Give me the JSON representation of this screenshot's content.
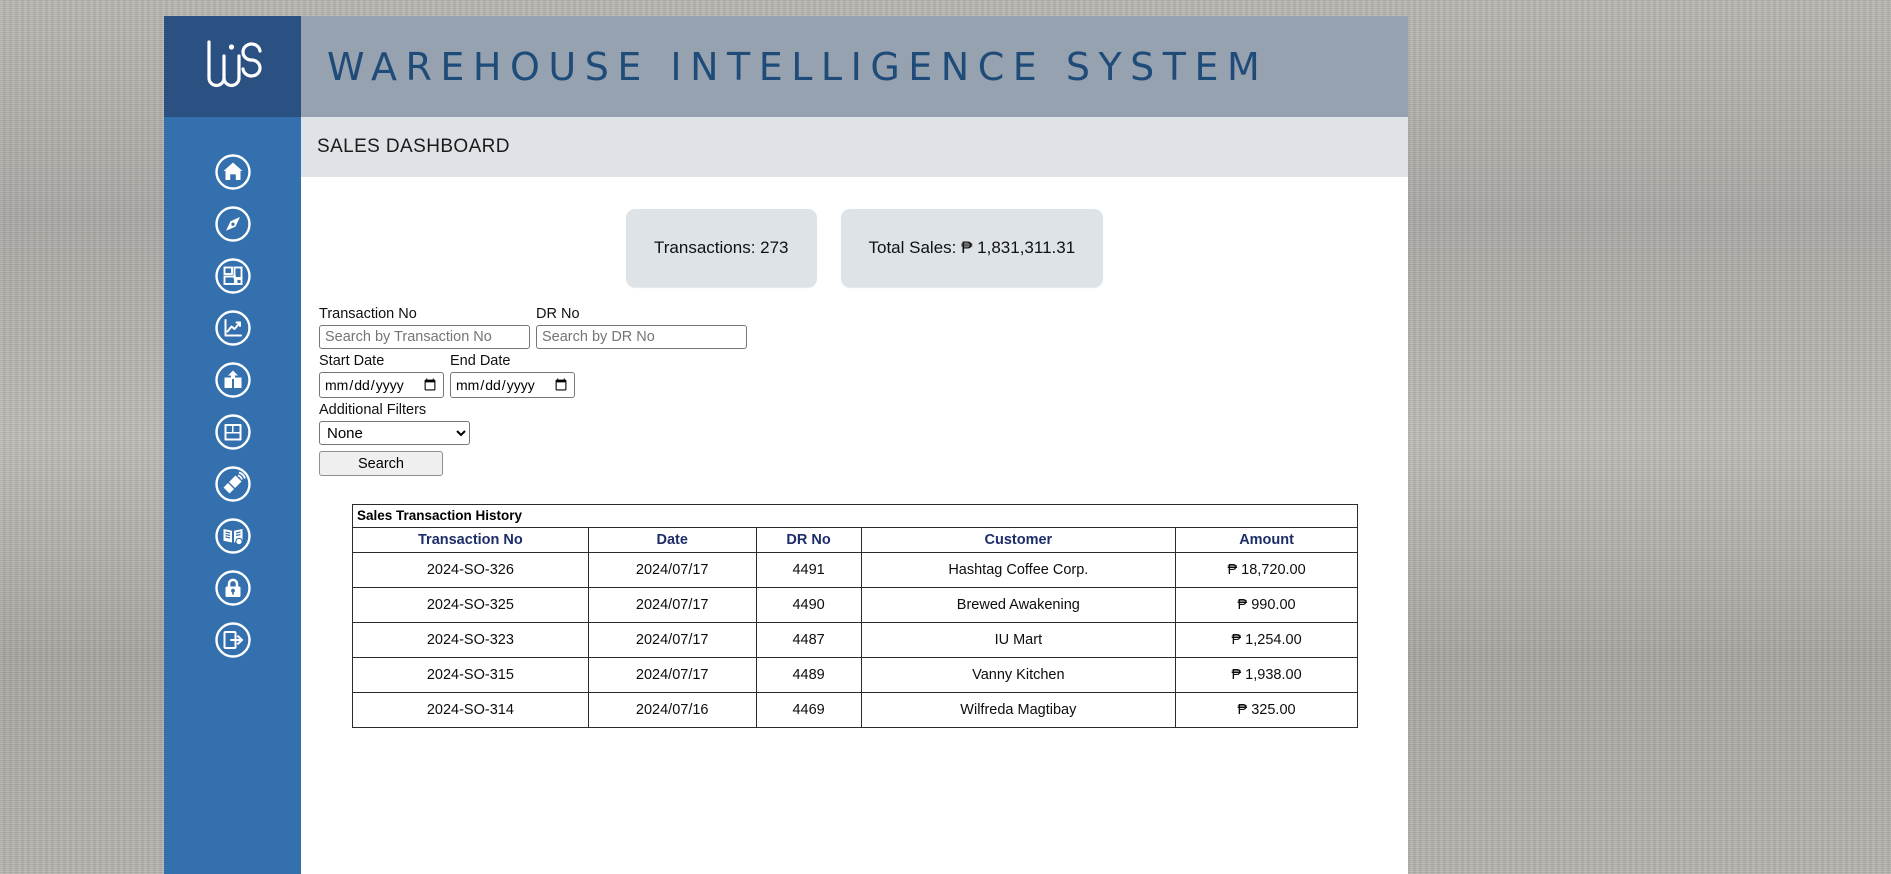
{
  "app": {
    "brand_title": "WAREHOUSE INTELLIGENCE SYSTEM",
    "logo_text": "WiS",
    "page_title": "SALES DASHBOARD",
    "colors": {
      "logo_bg": "#2b5182",
      "sidebar_bg": "#3470ad",
      "topbar_bg": "#97a2b0",
      "pagebar_bg": "#dfe3e7",
      "brand_text": "#1f4b79",
      "card_bg": "#dee3e8",
      "table_header_text": "#1c2d69"
    }
  },
  "sidebar": {
    "items": [
      {
        "icon": "home-icon",
        "label": "Home"
      },
      {
        "icon": "compass-icon",
        "label": "Navigate"
      },
      {
        "icon": "layout-grid-icon",
        "label": "Layout"
      },
      {
        "icon": "line-chart-icon",
        "label": "Analytics"
      },
      {
        "icon": "open-box-icon",
        "label": "Outbound"
      },
      {
        "icon": "box-stack-icon",
        "label": "Inventory"
      },
      {
        "icon": "megaphone-icon",
        "label": "Announcements"
      },
      {
        "icon": "open-book-icon",
        "label": "Catalog"
      },
      {
        "icon": "lock-icon",
        "label": "Security"
      },
      {
        "icon": "logout-icon",
        "label": "Logout"
      }
    ]
  },
  "stats": [
    {
      "label": "Transactions: 273"
    },
    {
      "label": "Total Sales: ₱ 1,831,311.31"
    }
  ],
  "filters": {
    "transaction_no": {
      "label": "Transaction No",
      "placeholder": "Search by Transaction No",
      "value": ""
    },
    "dr_no": {
      "label": "DR No",
      "placeholder": "Search by DR No",
      "value": ""
    },
    "start_date": {
      "label": "Start Date",
      "value": "",
      "format": "mm/dd/yyyy"
    },
    "end_date": {
      "label": "End Date",
      "value": "",
      "format": "mm/dd/yyyy"
    },
    "additional": {
      "label": "Additional Filters",
      "selected": "None",
      "options": [
        "None"
      ]
    },
    "search_button": "Search"
  },
  "table": {
    "caption": "Sales Transaction History",
    "columns": [
      "Transaction No",
      "Date",
      "DR No",
      "Customer",
      "Amount"
    ],
    "rows": [
      {
        "transaction_no": "2024-SO-326",
        "date": "2024/07/17",
        "dr_no": "4491",
        "customer": "Hashtag Coffee Corp.",
        "amount": "₱ 18,720.00"
      },
      {
        "transaction_no": "2024-SO-325",
        "date": "2024/07/17",
        "dr_no": "4490",
        "customer": "Brewed Awakening",
        "amount": "₱ 990.00"
      },
      {
        "transaction_no": "2024-SO-323",
        "date": "2024/07/17",
        "dr_no": "4487",
        "customer": "IU Mart",
        "amount": "₱ 1,254.00"
      },
      {
        "transaction_no": "2024-SO-315",
        "date": "2024/07/17",
        "dr_no": "4489",
        "customer": "Vanny Kitchen",
        "amount": "₱ 1,938.00"
      },
      {
        "transaction_no": "2024-SO-314",
        "date": "2024/07/16",
        "dr_no": "4469",
        "customer": "Wilfreda Magtibay",
        "amount": "₱ 325.00"
      }
    ]
  }
}
